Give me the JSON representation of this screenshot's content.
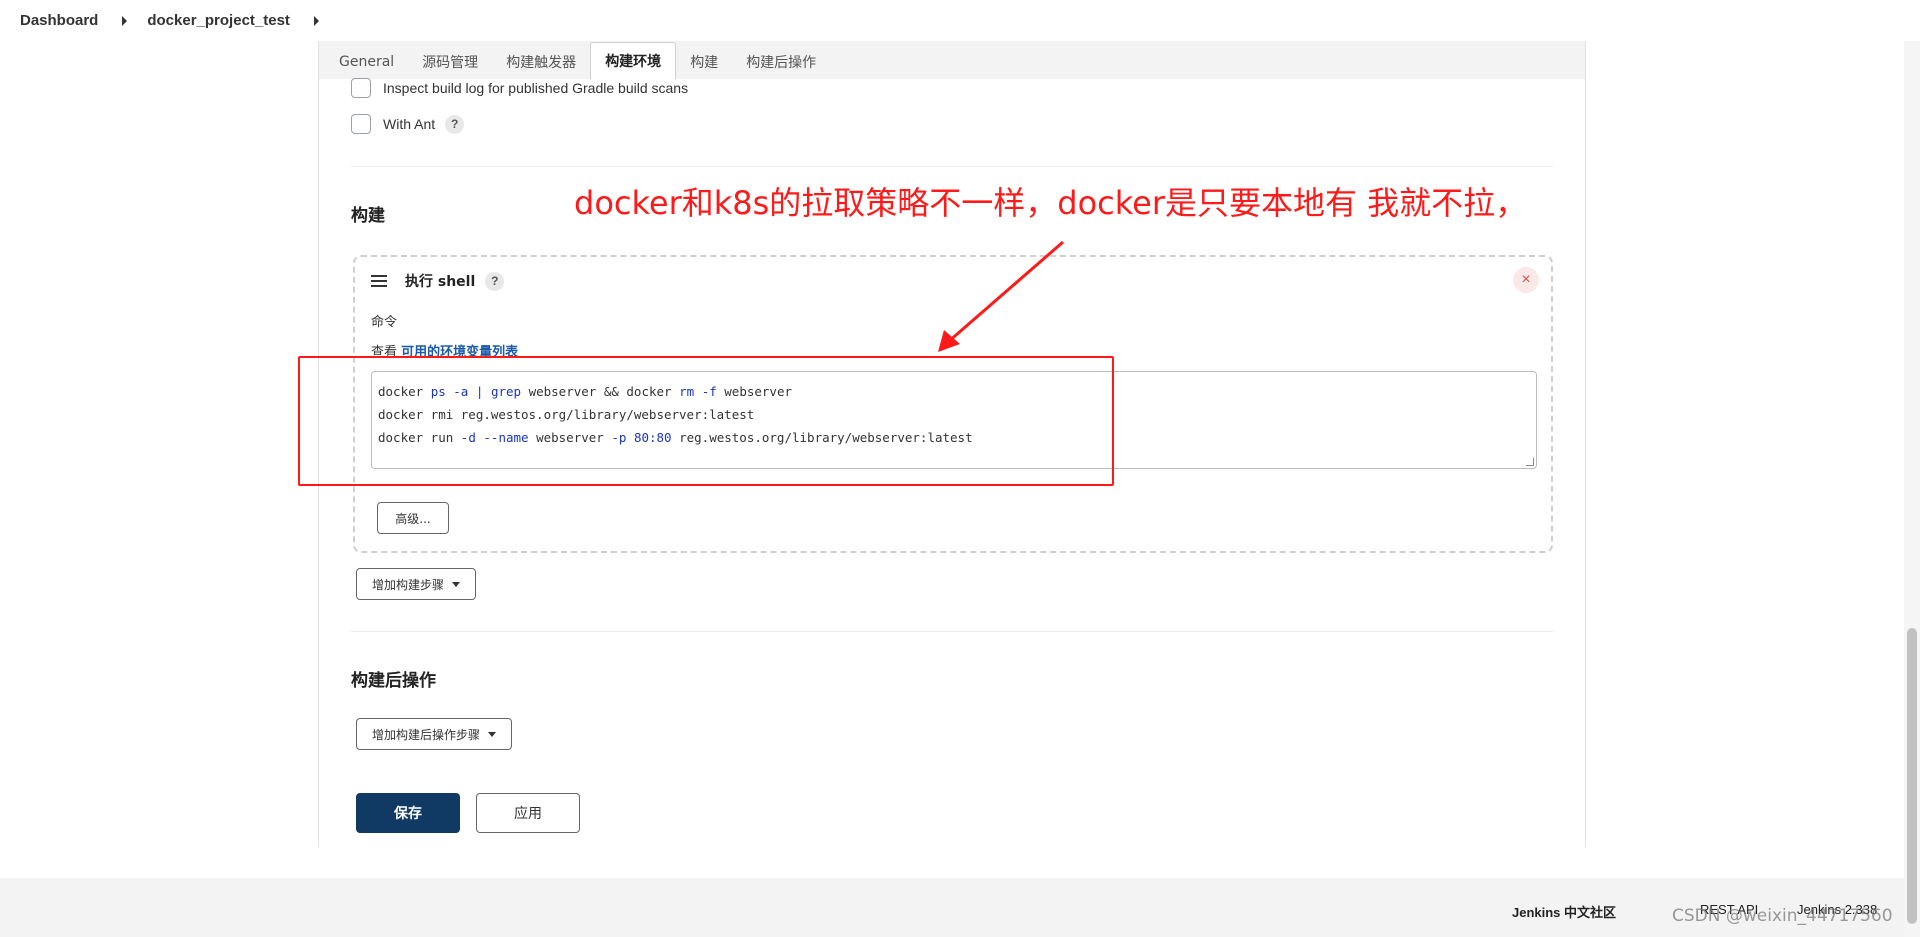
{
  "breadcrumb": {
    "items": [
      "Dashboard",
      "docker_project_test"
    ]
  },
  "tabs": [
    "General",
    "源码管理",
    "构建触发器",
    "构建环境",
    "构建",
    "构建后操作"
  ],
  "active_tab": "构建环境",
  "env_options": {
    "gradle_scan": "Inspect build log for published Gradle build scans",
    "with_ant": "With Ant",
    "help_glyph": "?"
  },
  "build_section": {
    "title": "构建",
    "step": {
      "title": "执行 shell",
      "close_glyph": "×",
      "command_label": "命令",
      "env_prefix": "查看",
      "env_link": "可用的环境变量列表",
      "command_lines": [
        "docker ps -a | grep webserver && docker rm -f webserver",
        "docker rmi reg.westos.org/library/webserver:latest",
        "docker run -d --name webserver -p 80:80 reg.westos.org/library/webserver:latest"
      ],
      "advanced_button": "高级..."
    },
    "add_step_button": "增加构建步骤"
  },
  "post_build": {
    "title": "构建后操作",
    "add_button": "增加构建后操作步骤"
  },
  "actions": {
    "save": "保存",
    "apply": "应用"
  },
  "annotation": {
    "text": "docker和k8s的拉取策略不一样，docker是只要本地有 我就不拉，",
    "color": "#ff1a1a"
  },
  "footer": {
    "community": "Jenkins 中文社区",
    "rest_api": "REST API",
    "version": "Jenkins 2.338"
  },
  "watermark": "CSDN @weixin_44717560",
  "colors": {
    "primary_button": "#103a63",
    "link": "#1a5aa8",
    "keyword": "#1a35c8"
  }
}
